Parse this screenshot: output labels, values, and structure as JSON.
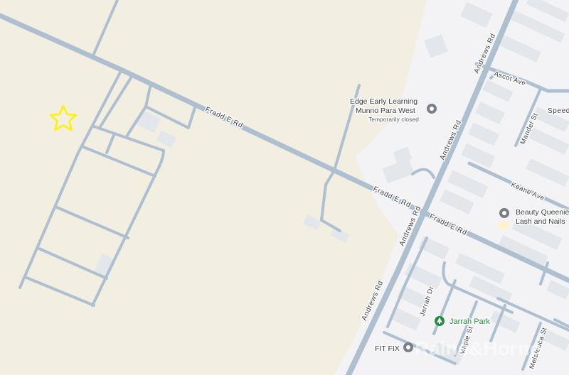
{
  "map": {
    "colors": {
      "land": "#f2eee2",
      "urban": "#f3f3f5",
      "road": "#aebfd0",
      "road_casing": "#c3cfdb",
      "building": "#e3e6ea",
      "marker_star": "#fff200",
      "park": "#1e8e3e",
      "poi_gray": "#7a7f85"
    },
    "roads": {
      "fradd_1": "Fradd E Rd",
      "fradd_2": "Fradd E Rd",
      "fradd_3": "Fradd E Rd",
      "andrews_1": "Andrews Rd",
      "andrews_2": "Andrews Rd",
      "andrews_3": "Andrews Rd",
      "andrews_4": "Andrews Rd",
      "ascot": "Ascot Ave",
      "mandel": "Mandel St",
      "keane": "Keane Ave",
      "jarrah_dr": "Jarrah Dr",
      "maple": "Maple St",
      "melaleuca": "Melaleuca St",
      "speed": "Speed"
    },
    "pois": {
      "edge_line1": "Edge Early Learning",
      "edge_line2": "Munno Para West",
      "edge_status": "Temporarily closed",
      "beauty_line1": "Beauty Queenie",
      "beauty_line2": "Lash and Nails",
      "jarrah_park": "Jarrah Park",
      "fit_fix": "FIT FIX"
    },
    "watermark": "Raine&Horne",
    "marker": "star-marker"
  }
}
